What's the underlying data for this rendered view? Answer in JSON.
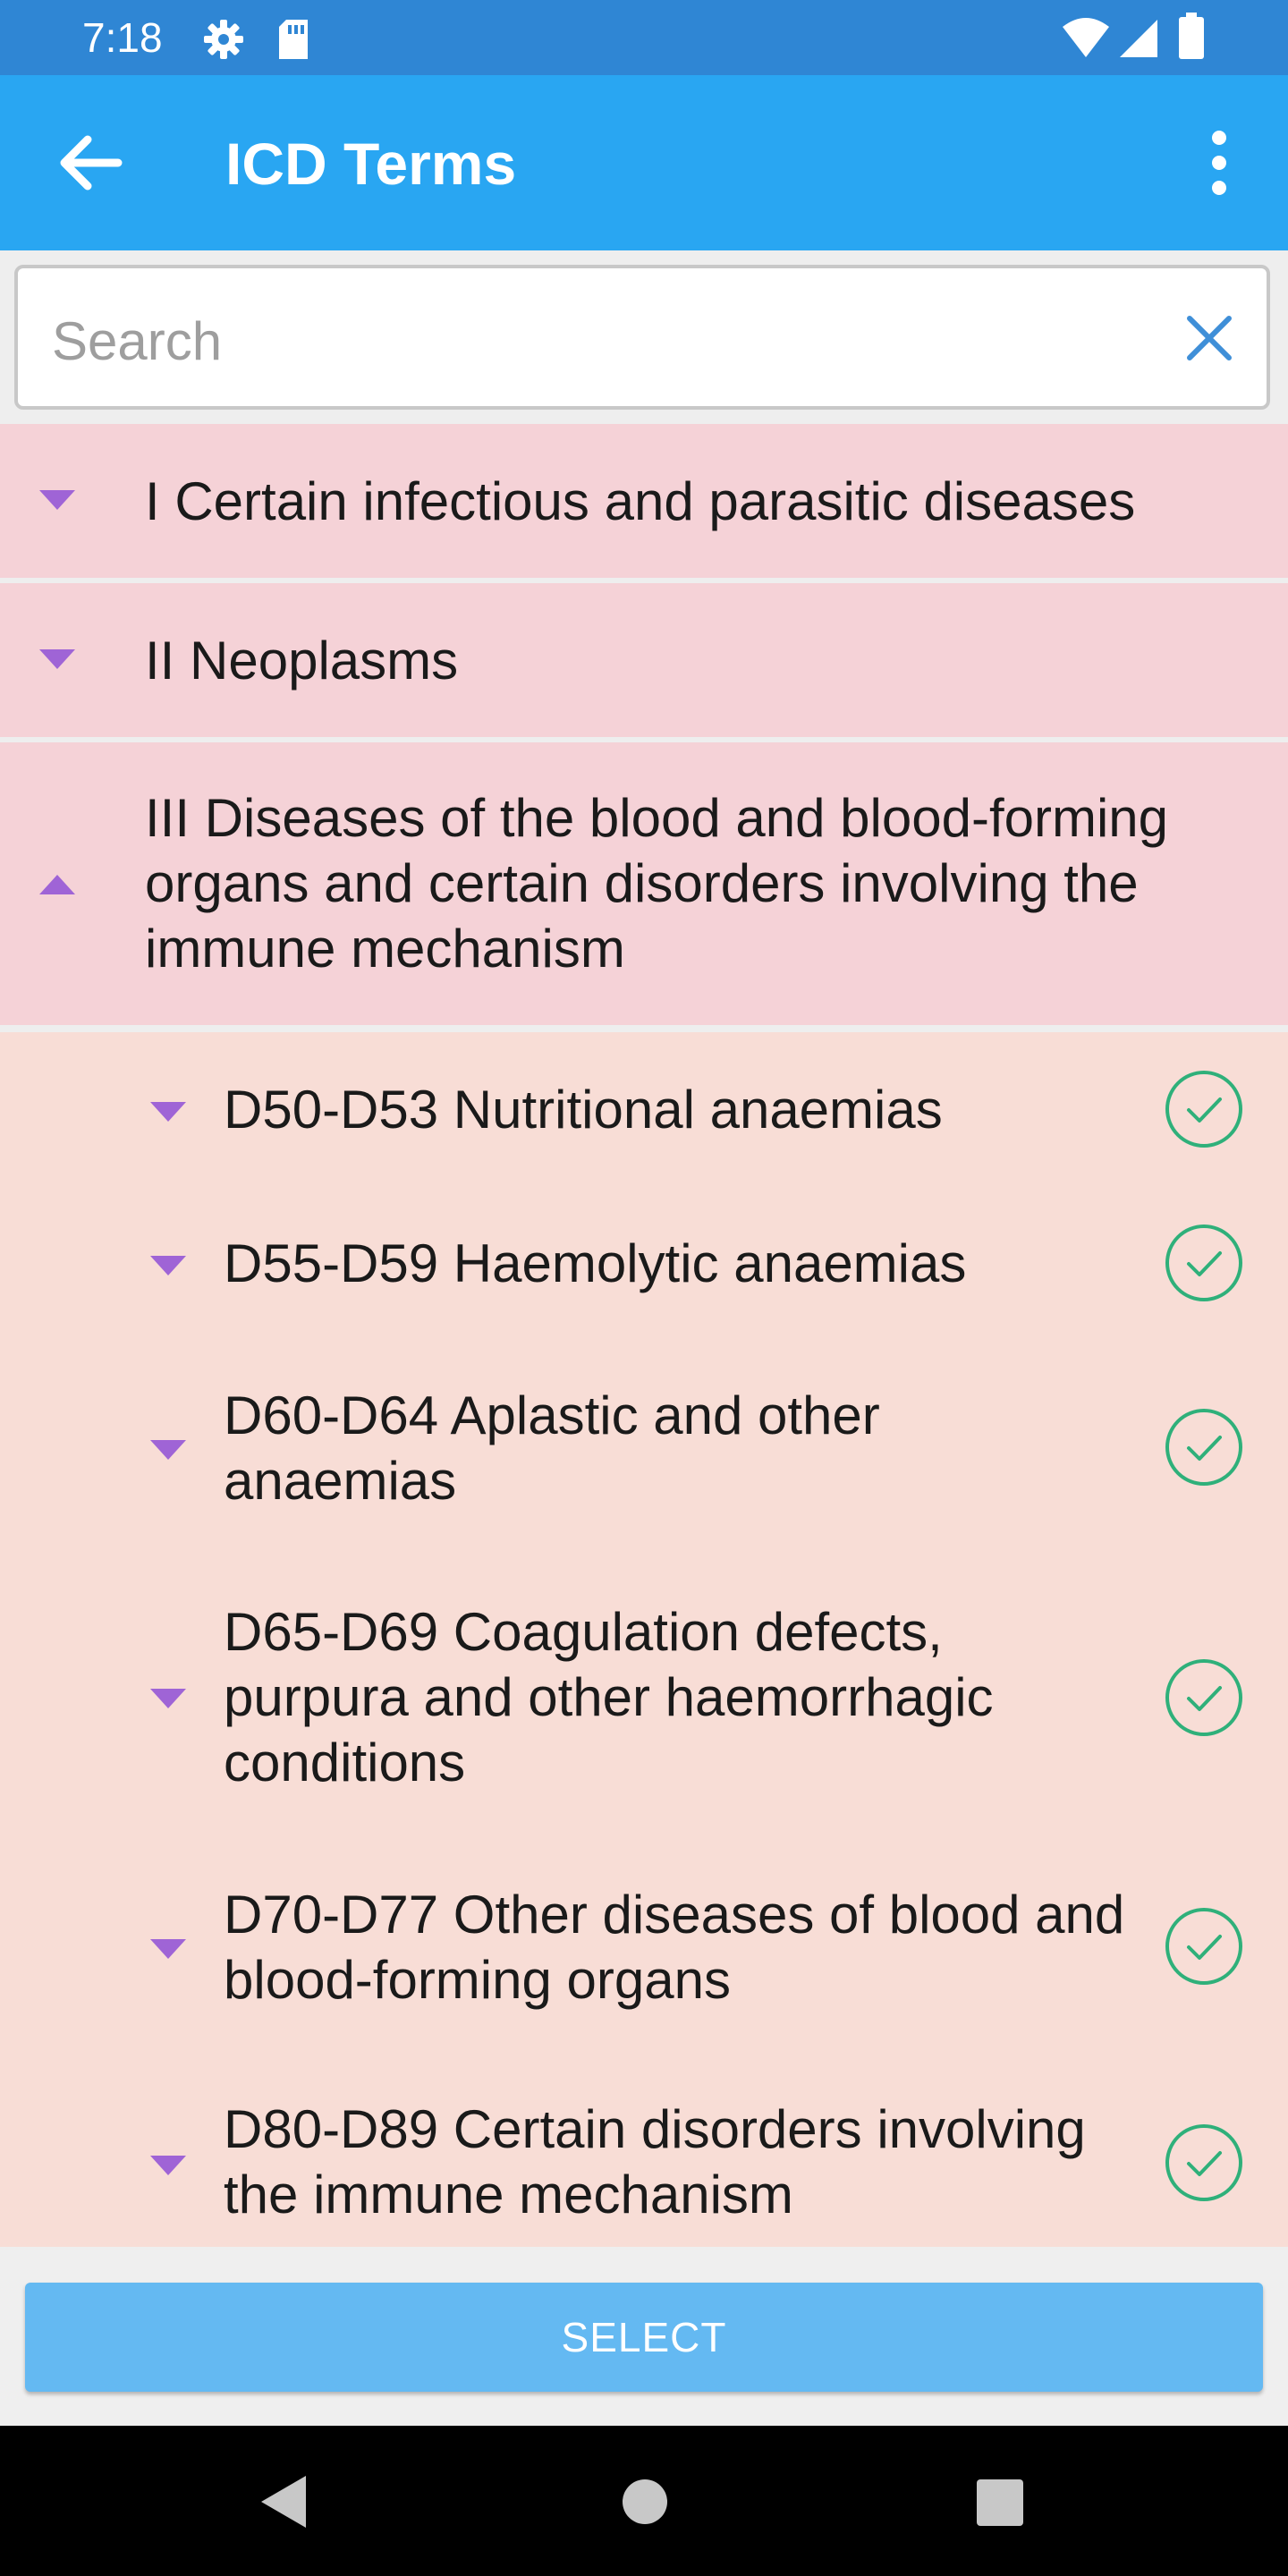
{
  "status_bar": {
    "time": "7:18",
    "icons": [
      "gear-icon",
      "sd-card-icon",
      "wifi-icon",
      "signal-icon",
      "battery-icon"
    ]
  },
  "app_bar": {
    "title": "ICD Terms",
    "back_icon": "arrow-back-icon",
    "menu_icon": "more-vert-icon"
  },
  "search": {
    "placeholder": "Search",
    "value": "",
    "clear_icon": "close-icon"
  },
  "chapters": [
    {
      "label": "I Certain infectious and parasitic diseases",
      "expanded": false
    },
    {
      "label": "II Neoplasms",
      "expanded": false
    },
    {
      "label": "III Diseases of the blood and blood-forming organs and certain disorders involving the immune mechanism",
      "expanded": true
    }
  ],
  "subgroups": [
    {
      "label": "D50-D53 Nutritional anaemias",
      "checked": true
    },
    {
      "label": "D55-D59 Haemolytic anaemias",
      "checked": true
    },
    {
      "label": "D60-D64 Aplastic and other anaemias",
      "checked": true
    },
    {
      "label": "D65-D69 Coagulation defects, purpura and other haemorrhagic conditions",
      "checked": true
    },
    {
      "label": "D70-D77 Other diseases of blood and blood-forming organs",
      "checked": true
    },
    {
      "label": "D80-D89 Certain disorders involving the immune mechanism",
      "checked": true
    }
  ],
  "footer": {
    "select_label": "SELECT"
  },
  "navigation": [
    "back-triangle-icon",
    "home-circle-icon",
    "recents-square-icon"
  ],
  "colors": {
    "status_bar": "#2f86d4",
    "app_bar": "#29a6f2",
    "chapter_bg": "#f5d2d7",
    "subgroup_bg": "#f8ddd6",
    "caret": "#9f64d6",
    "check": "#2fb07a",
    "select_button": "#64b9f2"
  }
}
